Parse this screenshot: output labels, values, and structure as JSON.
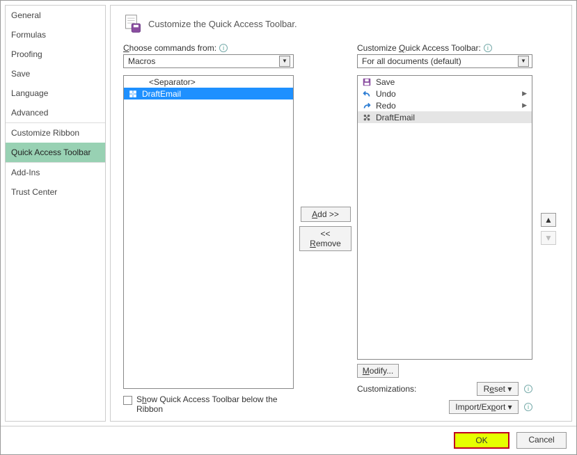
{
  "sidebar": {
    "items": [
      {
        "label": "General"
      },
      {
        "label": "Formulas"
      },
      {
        "label": "Proofing"
      },
      {
        "label": "Save"
      },
      {
        "label": "Language"
      },
      {
        "label": "Advanced"
      },
      {
        "label": "Customize Ribbon"
      },
      {
        "label": "Quick Access Toolbar"
      },
      {
        "label": "Add-Ins"
      },
      {
        "label": "Trust Center"
      }
    ],
    "selected_index": 7
  },
  "heading": "Customize the Quick Access Toolbar.",
  "left": {
    "label_pre": "C",
    "label_rest": "hoose commands from:",
    "dropdown_value": "Macros",
    "items": [
      {
        "type": "sep",
        "label": "<Separator>"
      },
      {
        "type": "macro",
        "label": "DraftEmail",
        "selected": true
      }
    ]
  },
  "right": {
    "label_pre": "Customize ",
    "label_u": "Q",
    "label_rest": "uick Access Toolbar:",
    "dropdown_value": "For all documents (default)",
    "items": [
      {
        "icon": "save",
        "label": "Save"
      },
      {
        "icon": "undo",
        "label": "Undo",
        "expand": true
      },
      {
        "icon": "redo",
        "label": "Redo",
        "expand": true
      },
      {
        "icon": "macro",
        "label": "DraftEmail",
        "light": true
      }
    ]
  },
  "buttons": {
    "add_pre": "A",
    "add_rest": "dd >>",
    "remove_pre": "<< ",
    "remove_u": "R",
    "remove_rest": "emove",
    "modify_pre": "M",
    "modify_rest": "odify...",
    "reset_pre": "R",
    "reset_u": "e",
    "reset_rest": "set ▾",
    "import_pre": "Import/Ex",
    "import_u": "p",
    "import_rest": "ort ▾",
    "ok": "OK",
    "cancel": "Cancel"
  },
  "checkbox": {
    "pre": "S",
    "u": "h",
    "rest": "ow Quick Access Toolbar below the Ribbon"
  },
  "customizations_label": "Customizations:"
}
